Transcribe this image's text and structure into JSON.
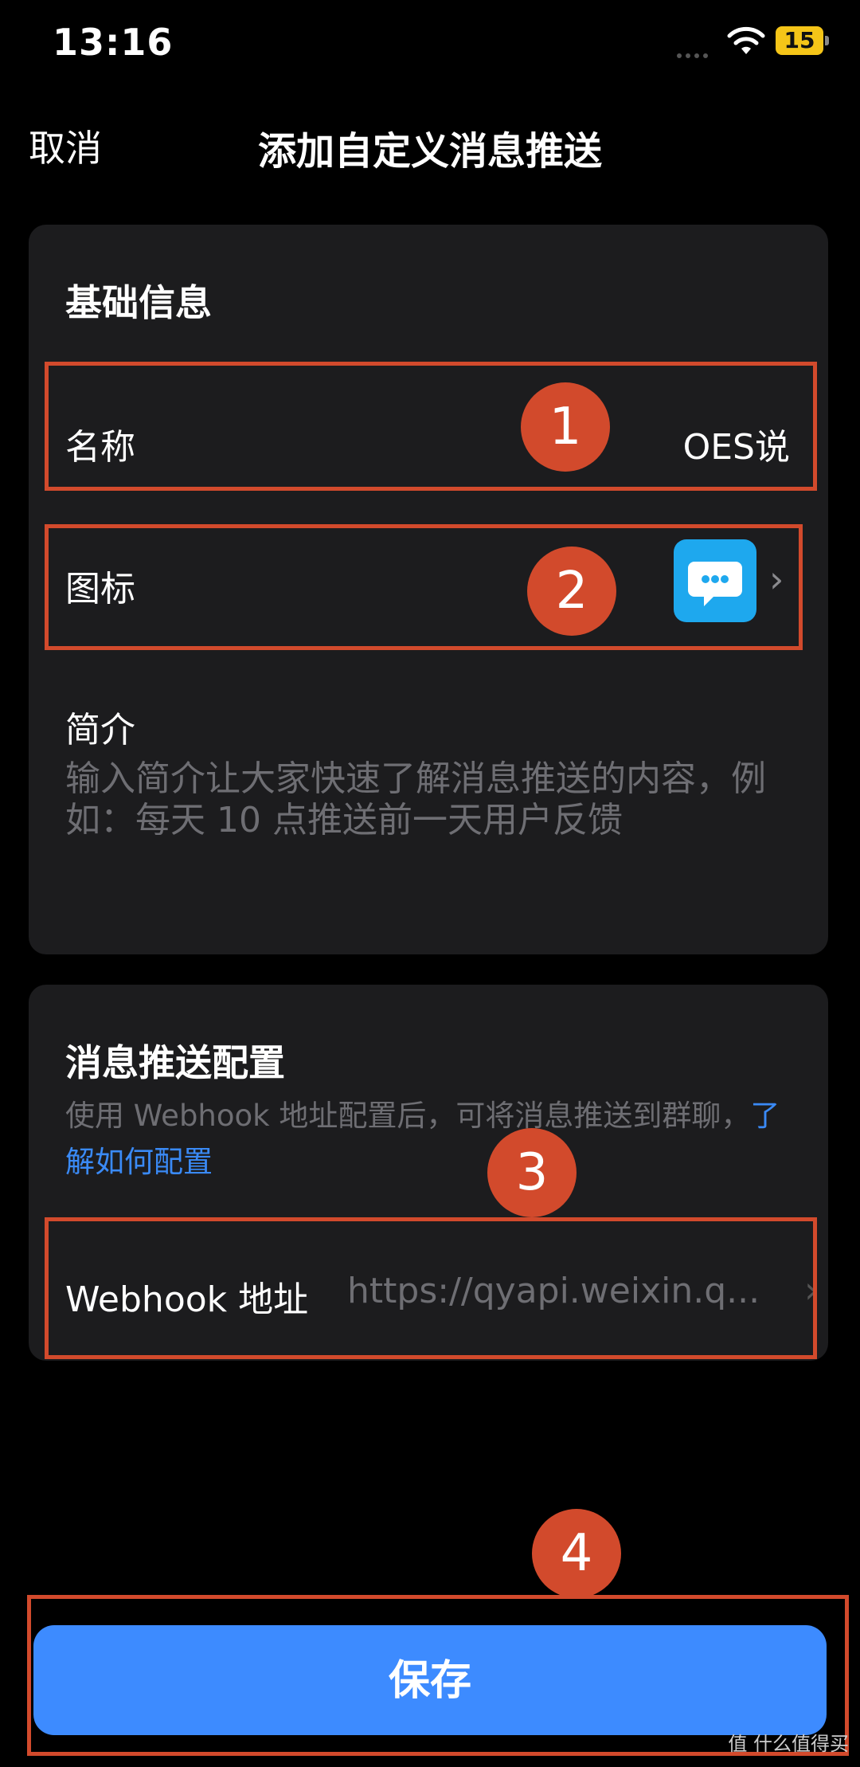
{
  "status_bar": {
    "time": "13:16",
    "battery": "15"
  },
  "nav": {
    "cancel_label": "取消",
    "title": "添加自定义消息推送"
  },
  "basic_info": {
    "section_title": "基础信息",
    "name_label": "名称",
    "name_value": "OES说",
    "icon_label": "图标",
    "intro_label": "简介",
    "intro_placeholder": "输入简介让大家快速了解消息推送的内容，例如：每天 10 点推送前一天用户反馈"
  },
  "push_config": {
    "section_title": "消息推送配置",
    "description": "使用 Webhook 地址配置后，可将消息推送到群聊，",
    "link_text": "了解如何配置",
    "webhook_label": "Webhook 地址",
    "webhook_value": "https://qyapi.weixin.q..."
  },
  "annotations": [
    "1",
    "2",
    "3",
    "4"
  ],
  "save_label": "保存",
  "watermark": "值 什么值得买",
  "colors": {
    "accent": "#3d8bff",
    "link": "#3a8af6",
    "annotation": "#d24a2c",
    "card": "#1c1c1e",
    "app_icon": "#1ea8ee"
  }
}
